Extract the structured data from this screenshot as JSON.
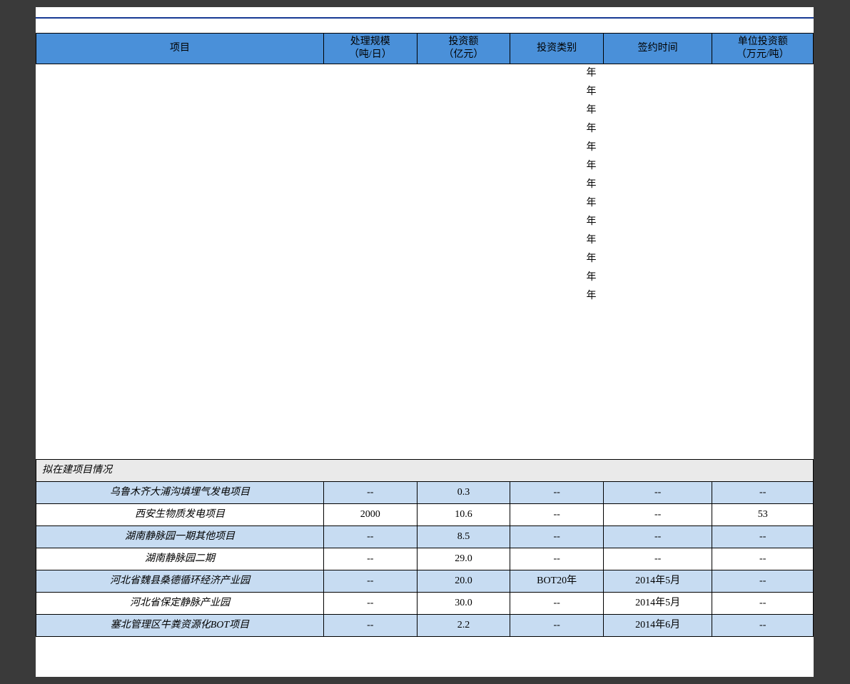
{
  "headers": {
    "col1": "项目",
    "col2_line1": "处理规模",
    "col2_line2": "（吨/日）",
    "col3_line1": "投资额",
    "col3_line2": "（亿元）",
    "col4": "投资类别",
    "col5": "签约时间",
    "col6_line1": "单位投资额",
    "col6_line2": "（万元/吨）"
  },
  "obscured_col4_char": "年",
  "section2_title": "拟在建项目情况",
  "section2_rows": [
    {
      "proj": "乌鲁木齐大浦沟填埋气发电项目",
      "c2": "--",
      "c3": "0.3",
      "c4": "--",
      "c5": "--",
      "c6": "--"
    },
    {
      "proj": "西安生物质发电项目",
      "c2": "2000",
      "c3": "10.6",
      "c4": "--",
      "c5": "--",
      "c6": "53"
    },
    {
      "proj": "湖南静脉园一期其他项目",
      "c2": "--",
      "c3": "8.5",
      "c4": "--",
      "c5": "--",
      "c6": "--"
    },
    {
      "proj": "湖南静脉园二期",
      "c2": "--",
      "c3": "29.0",
      "c4": "--",
      "c5": "--",
      "c6": "--"
    },
    {
      "proj": "河北省魏县桑德循环经济产业园",
      "c2": "--",
      "c3": "20.0",
      "c4": "BOT20年",
      "c5": "2014年5月",
      "c6": "--"
    },
    {
      "proj": "河北省保定静脉产业园",
      "c2": "--",
      "c3": "30.0",
      "c4": "--",
      "c5": "2014年5月",
      "c6": "--"
    },
    {
      "proj": "塞北管理区牛粪资源化BOT项目",
      "c2": "--",
      "c3": "2.2",
      "c4": "--",
      "c5": "2014年6月",
      "c6": "--"
    }
  ],
  "chart_data": {
    "type": "table",
    "title": "拟在建项目情况",
    "columns": [
      "项目",
      "处理规模（吨/日）",
      "投资额（亿元）",
      "投资类别",
      "签约时间",
      "单位投资额（万元/吨）"
    ],
    "rows": [
      [
        "乌鲁木齐大浦沟填埋气发电项目",
        null,
        0.3,
        null,
        null,
        null
      ],
      [
        "西安生物质发电项目",
        2000,
        10.6,
        null,
        null,
        53
      ],
      [
        "湖南静脉园一期其他项目",
        null,
        8.5,
        null,
        null,
        null
      ],
      [
        "湖南静脉园二期",
        null,
        29.0,
        null,
        null,
        null
      ],
      [
        "河北省魏县桑德循环经济产业园",
        null,
        20.0,
        "BOT20年",
        "2014年5月",
        null
      ],
      [
        "河北省保定静脉产业园",
        null,
        30.0,
        null,
        "2014年5月",
        null
      ],
      [
        "塞北管理区牛粪资源化BOT项目",
        null,
        2.2,
        null,
        "2014年6月",
        null
      ]
    ]
  }
}
